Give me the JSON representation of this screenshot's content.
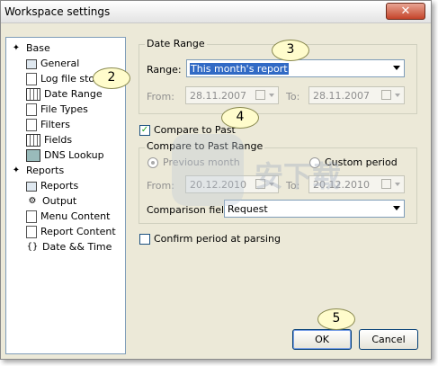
{
  "window": {
    "title": "Workspace settings"
  },
  "tree": {
    "items": [
      {
        "label": "Base",
        "icon": "diamond-icon",
        "level": 0
      },
      {
        "label": "General",
        "icon": "settings-icon",
        "level": 1
      },
      {
        "label": "Log file sto...",
        "icon": "log-icon",
        "level": 1
      },
      {
        "label": "Date Range",
        "icon": "grid-icon",
        "level": 1
      },
      {
        "label": "File Types",
        "icon": "files-icon",
        "level": 1
      },
      {
        "label": "Filters",
        "icon": "filter-icon",
        "level": 1
      },
      {
        "label": "Fields",
        "icon": "table-icon",
        "level": 1
      },
      {
        "label": "DNS Lookup",
        "icon": "monitor-icon",
        "level": 1
      },
      {
        "label": "Reports",
        "icon": "diamond-icon",
        "level": 0
      },
      {
        "label": "Reports",
        "icon": "report-icon",
        "level": 1
      },
      {
        "label": "Output",
        "icon": "output-icon",
        "level": 1
      },
      {
        "label": "Menu Content",
        "icon": "page-icon",
        "level": 1
      },
      {
        "label": "Report Content",
        "icon": "page-icon",
        "level": 1
      },
      {
        "label": "Date && Time",
        "icon": "braces-icon",
        "level": 1
      }
    ]
  },
  "date_range": {
    "group_label": "Date Range",
    "range_label": "Range:",
    "range_value": "This month's report",
    "from_label": "From:",
    "from_value": "28.11.2007",
    "to_label": "To:",
    "to_value": "28.11.2007"
  },
  "compare": {
    "checkbox_label": "Compare to Past",
    "checked": true,
    "group_label": "Compare to Past Range",
    "previous_month_label": "Previous month",
    "custom_period_label": "Custom period",
    "from_label": "From:",
    "from_value": "20.12.2010",
    "to_label": "To:",
    "to_value": "20.12.2010",
    "field_label": "Comparison field:",
    "field_value": "Request"
  },
  "confirm": {
    "label": "Confirm period at parsing",
    "checked": false
  },
  "buttons": {
    "ok": "OK",
    "cancel": "Cancel"
  },
  "callouts": {
    "c2": "2",
    "c3": "3",
    "c4": "4",
    "c5": "5"
  }
}
